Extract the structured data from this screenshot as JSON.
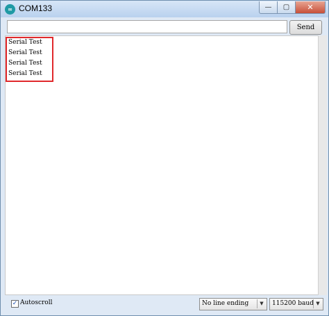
{
  "window": {
    "title": "COM133",
    "icon": "arduino-icon",
    "controls": {
      "minimize": "—",
      "maximize": "▢",
      "close": "✕"
    }
  },
  "input": {
    "value": "",
    "placeholder": ""
  },
  "send_label": "Send",
  "output": {
    "lines": [
      "Serial Test",
      "Serial Test",
      "Serial Test",
      "Serial Test"
    ]
  },
  "footer": {
    "autoscroll_label": "Autoscroll",
    "autoscroll_checked": true,
    "line_ending": "No line ending",
    "baud_rate": "115200 baud"
  },
  "colors": {
    "highlight": "#e0282b",
    "titlebar": "#b9d1ee"
  }
}
